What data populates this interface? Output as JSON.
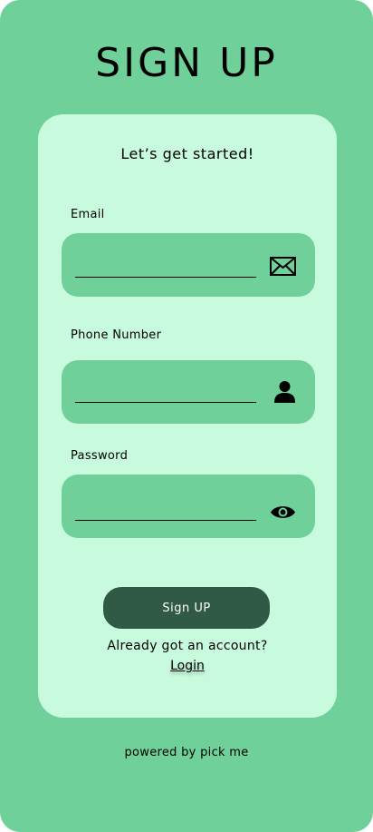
{
  "header": {
    "title": "SIGN UP"
  },
  "card": {
    "tagline": "Let’s get started!",
    "fields": [
      {
        "label": "Email",
        "value": "",
        "placeholder": "",
        "icon": "envelope-icon"
      },
      {
        "label": "Phone Number",
        "value": "",
        "placeholder": "",
        "icon": "user-icon"
      },
      {
        "label": "Password",
        "value": "",
        "placeholder": "",
        "icon": "eye-icon"
      }
    ],
    "submit_label": "Sign UP",
    "already_text": "Already got an account?",
    "login_label": "Login"
  },
  "footer": {
    "text": "powered by pick me"
  },
  "colors": {
    "background": "#70d09a",
    "card": "#c8fbdd",
    "field": "#70d09a",
    "button": "#305a45",
    "button_text": "#ffffff"
  }
}
